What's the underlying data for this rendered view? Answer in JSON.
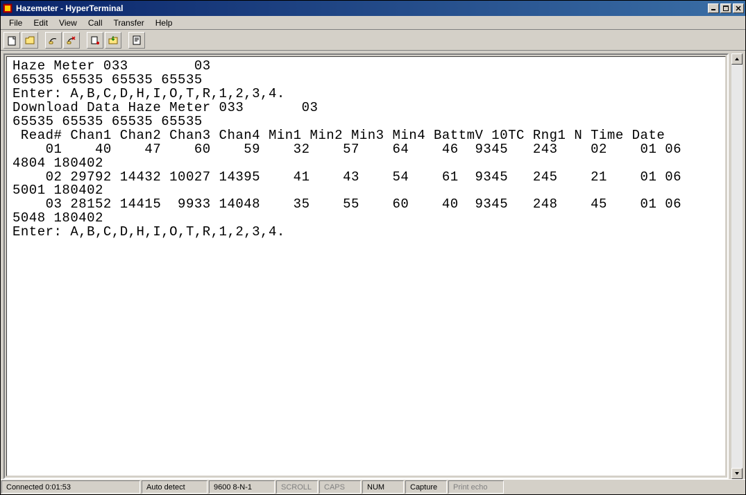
{
  "titlebar": {
    "title": "Hazemeter - HyperTerminal"
  },
  "menu": {
    "file": "File",
    "edit": "Edit",
    "view": "View",
    "call": "Call",
    "transfer": "Transfer",
    "help": "Help"
  },
  "terminal": {
    "content": "Haze Meter 033        03\n65535 65535 65535 65535\nEnter: A,B,C,D,H,I,O,T,R,1,2,3,4.\nDownload Data Haze Meter 033       03\n65535 65535 65535 65535\n Read# Chan1 Chan2 Chan3 Chan4 Min1 Min2 Min3 Min4 BattmV 10TC Rng1 N Time Date\n    01    40    47    60    59    32    57    64    46  9345   243    02    01 06\n4804 180402\n    02 29792 14432 10027 14395    41    43    54    61  9345   245    21    01 06\n5001 180402\n    03 28152 14415  9933 14048    35    55    60    40  9345   248    45    01 06\n5048 180402\nEnter: A,B,C,D,H,I,O,T,R,1,2,3,4."
  },
  "status": {
    "connected": "Connected 0:01:53",
    "auto": "Auto detect",
    "settings": "9600 8-N-1",
    "scroll": "SCROLL",
    "caps": "CAPS",
    "num": "NUM",
    "capture": "Capture",
    "printecho": "Print echo"
  }
}
